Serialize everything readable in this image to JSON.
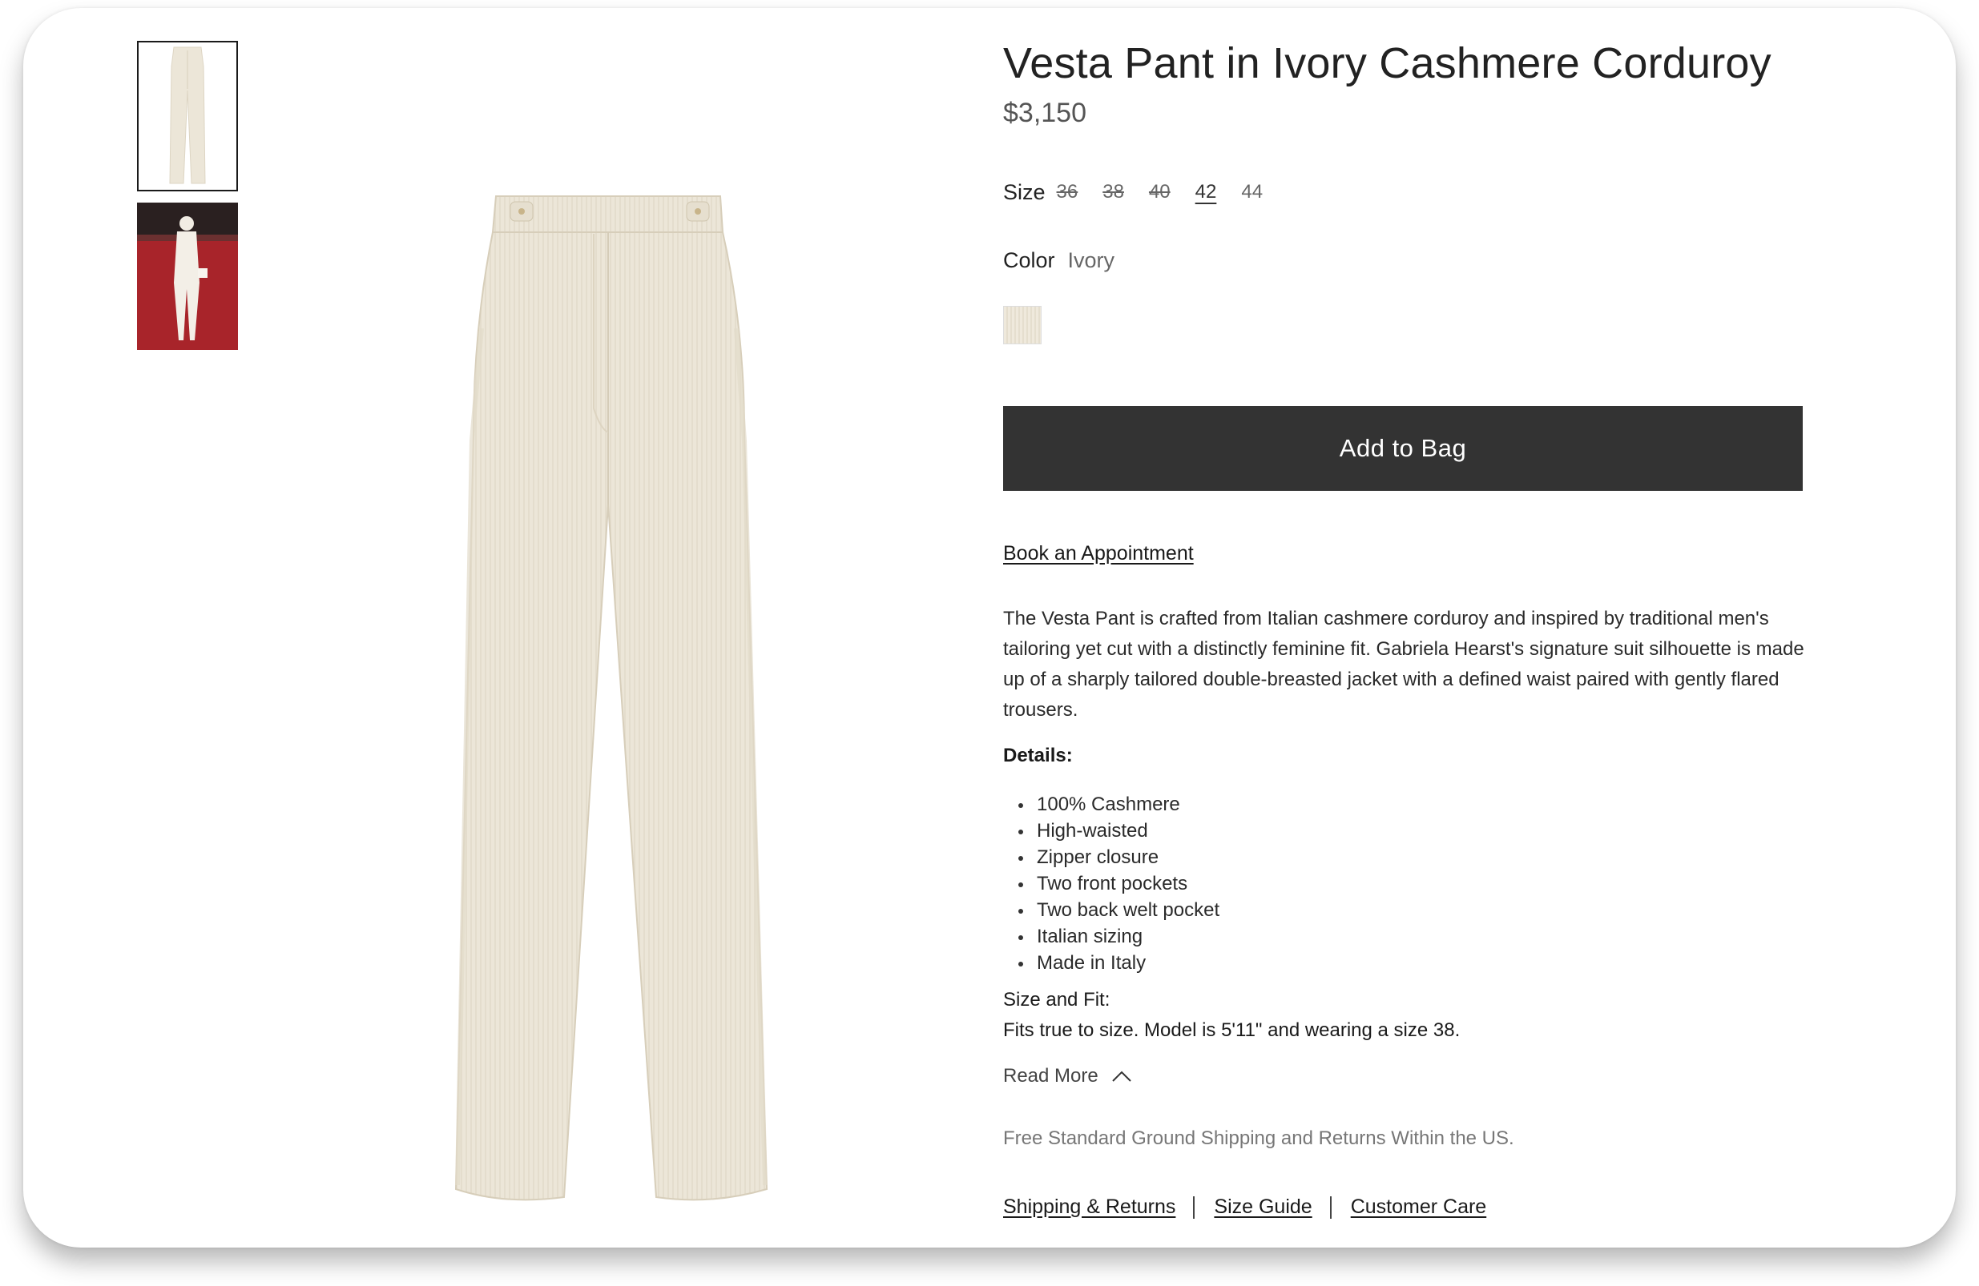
{
  "product": {
    "title": "Vesta Pant in Ivory Cashmere Corduroy",
    "price": "$3,150"
  },
  "size": {
    "label": "Size",
    "options": [
      {
        "label": "36",
        "available": false
      },
      {
        "label": "38",
        "available": false
      },
      {
        "label": "40",
        "available": false
      },
      {
        "label": "42",
        "available": true,
        "selected": true
      },
      {
        "label": "44",
        "available": true
      }
    ]
  },
  "color": {
    "label": "Color",
    "value": "Ivory",
    "swatch_color": "#ece6d8"
  },
  "actions": {
    "add_to_bag": "Add to Bag",
    "book_appointment": "Book an Appointment"
  },
  "description": "The Vesta Pant is crafted from Italian cashmere corduroy and inspired by traditional men's tailoring yet cut with a distinctly feminine fit. Gabriela Hearst's signature suit silhouette is made up of a sharply tailored double-breasted jacket with a defined waist paired with gently flared trousers.",
  "details": {
    "heading": "Details:",
    "items": [
      "100% Cashmere",
      "High-waisted",
      "Zipper closure",
      "Two front pockets",
      "Two back welt pocket",
      "Italian sizing",
      "Made in Italy"
    ]
  },
  "size_fit": {
    "heading": "Size and Fit:",
    "text": "Fits true to size. Model is 5'11\" and wearing a size 38."
  },
  "read_more": {
    "label": "Read More",
    "icon": "chevron-up-icon"
  },
  "shipping_note": "Free Standard Ground Shipping and Returns Within the US.",
  "footer_links": [
    "Shipping & Returns",
    "Size Guide",
    "Customer Care"
  ],
  "colors": {
    "button_bg": "#333333",
    "product_cream": "#ece6d8",
    "runway_red": "#a8242a"
  }
}
